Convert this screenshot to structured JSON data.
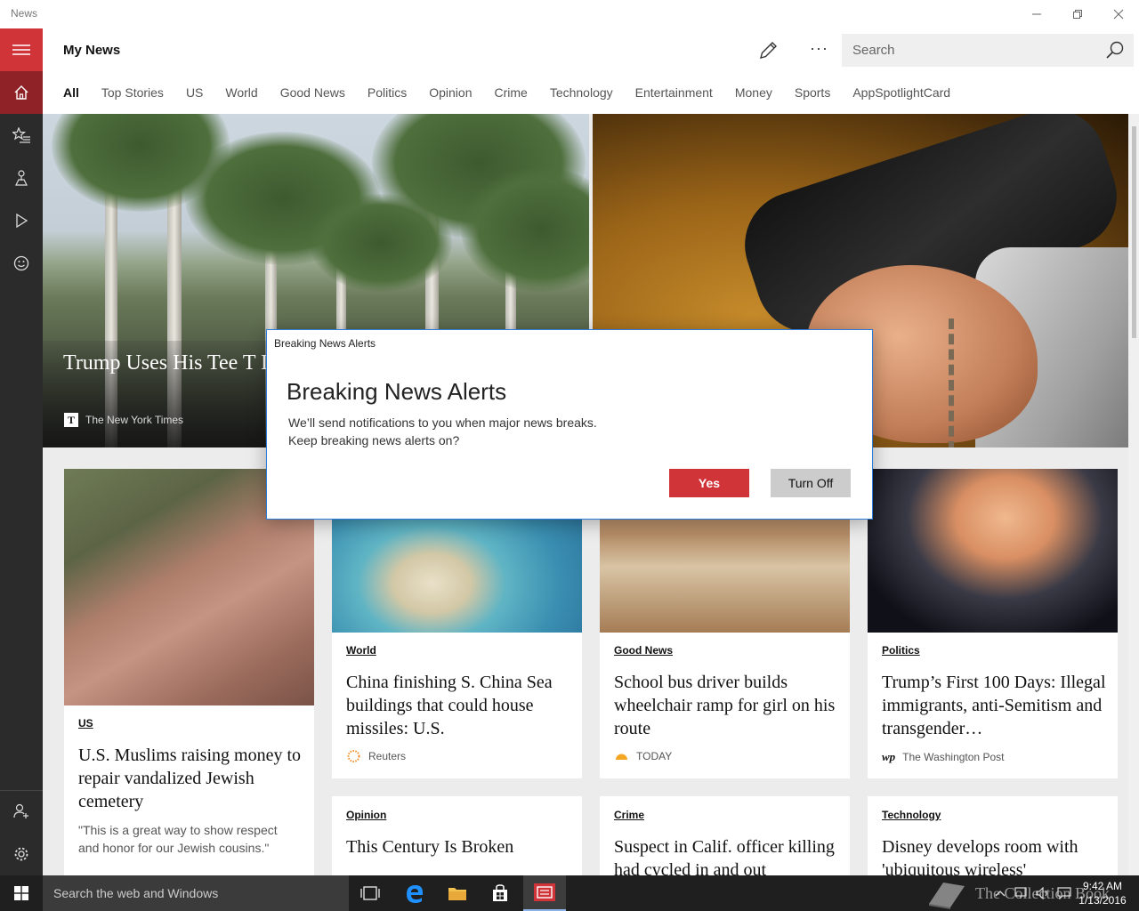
{
  "window": {
    "title": "News"
  },
  "header": {
    "title": "My News",
    "more_label": "···",
    "search_placeholder": "Search"
  },
  "tabs": [
    "All",
    "Top Stories",
    "US",
    "World",
    "Good News",
    "Politics",
    "Opinion",
    "Crime",
    "Technology",
    "Entertainment",
    "Money",
    "Sports",
    "AppSpotlightCard"
  ],
  "hero": {
    "title": "Trump Uses His Tee T Diplomacy and Recre",
    "source": "The New York Times",
    "source_logo": "T"
  },
  "cards": [
    {
      "category": "US",
      "headline": "U.S. Muslims raising money to repair vandalized Jewish cemetery",
      "snippet": "\"This is a great way to show respect and honor for our Jewish cousins.\""
    },
    {
      "category": "World",
      "headline": "China finishing S. China Sea buildings that could house missiles: U.S.",
      "source": "Reuters"
    },
    {
      "category": "Good News",
      "headline": "School bus driver builds wheelchair ramp for girl on his route",
      "source": "TODAY"
    },
    {
      "category": "Politics",
      "headline": "Trump’s First 100 Days: Illegal immigrants, anti-Semitism and transgender…",
      "source": "The Washington Post",
      "source_logo": "wp"
    },
    {
      "category": "Opinion",
      "headline": "This Century Is Broken"
    },
    {
      "category": "Crime",
      "headline": "Suspect in Calif. officer killing had cycled in and out"
    },
    {
      "category": "Technology",
      "headline": "Disney develops room with 'ubiquitous wireless'"
    }
  ],
  "dialog": {
    "window_title": "Breaking News Alerts",
    "heading": "Breaking News Alerts",
    "line1": "We’ll send notifications to you when major news breaks.",
    "line2": "Keep breaking news alerts on?",
    "yes_label": "Yes",
    "off_label": "Turn Off"
  },
  "taskbar": {
    "search_placeholder": "Search the web and Windows",
    "time": "9:42 AM",
    "date": "1/13/2016",
    "watermark": "The Collection Book"
  },
  "colors": {
    "accent": "#d13438",
    "rail": "#2b2b2b",
    "taskbar": "#1f1f1f"
  }
}
